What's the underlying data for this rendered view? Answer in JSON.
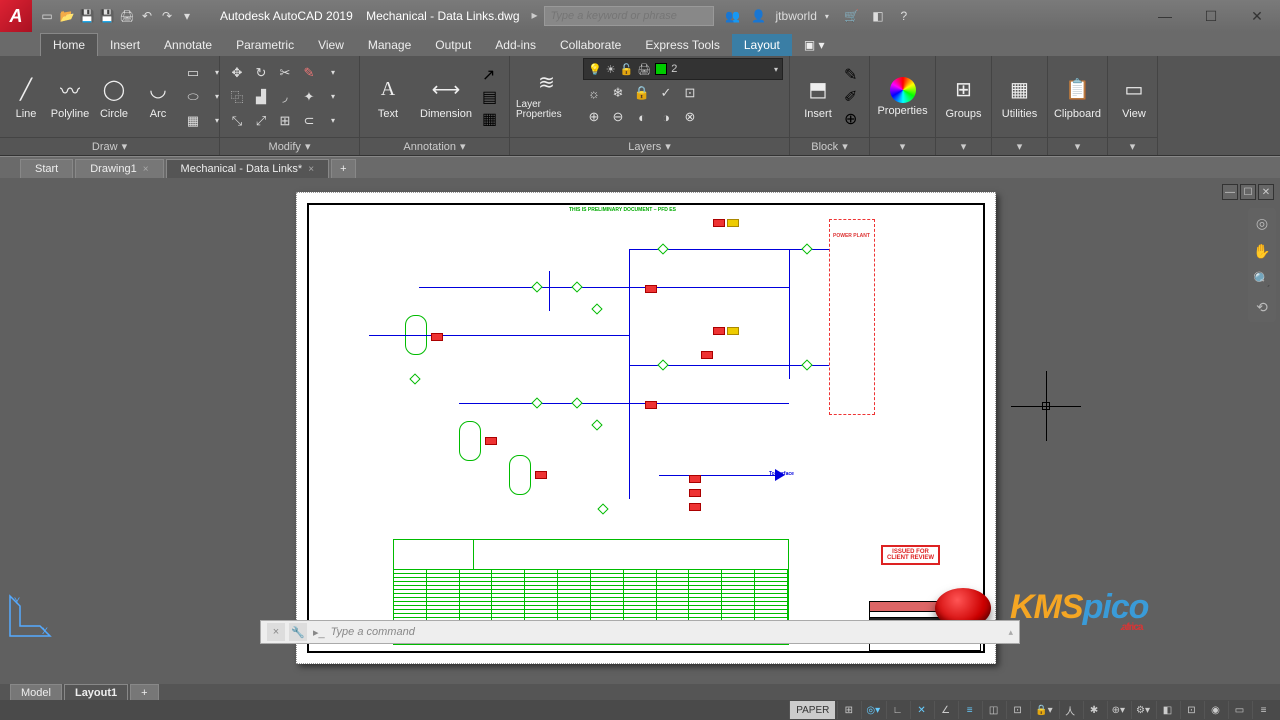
{
  "title": {
    "app": "Autodesk AutoCAD 2019",
    "file": "Mechanical - Data Links.dwg"
  },
  "search_placeholder": "Type a keyword or phrase",
  "user": "jtbworld",
  "menu": {
    "items": [
      "Home",
      "Insert",
      "Annotate",
      "Parametric",
      "View",
      "Manage",
      "Output",
      "Add-ins",
      "Collaborate",
      "Express Tools",
      "Layout"
    ],
    "active": "Home",
    "highlight": "Layout"
  },
  "ribbon": {
    "draw": {
      "label": "Draw",
      "btns": [
        "Line",
        "Polyline",
        "Circle",
        "Arc"
      ]
    },
    "modify": {
      "label": "Modify"
    },
    "annot": {
      "label": "Annotation",
      "btns": [
        "Text",
        "Dimension"
      ]
    },
    "layers": {
      "label": "Layers",
      "btn": "Layer Properties",
      "current": "2"
    },
    "block": {
      "label": "Block",
      "btn": "Insert"
    },
    "props": "Properties",
    "groups": "Groups",
    "utils": "Utilities",
    "clip": "Clipboard",
    "view": "View"
  },
  "filetabs": {
    "items": [
      "Start",
      "Drawing1",
      "Mechanical - Data Links*"
    ],
    "active": 2
  },
  "drawing": {
    "banner": "THIS IS PRELIMINARY DOCUMENT – PFD ES",
    "powerplant": "POWER PLANT",
    "stamp_l1": "ISSUED FOR",
    "stamp_l2": "CLIENT REVIEW",
    "arrow_label": "To surface"
  },
  "cmd": {
    "placeholder": "Type a command"
  },
  "bottomtabs": {
    "items": [
      "Model",
      "Layout1"
    ],
    "active": 1
  },
  "status": {
    "space": "PAPER"
  },
  "watermark": {
    "brand1": "KMS",
    "brand2": "pico",
    "sub": ".africa"
  }
}
